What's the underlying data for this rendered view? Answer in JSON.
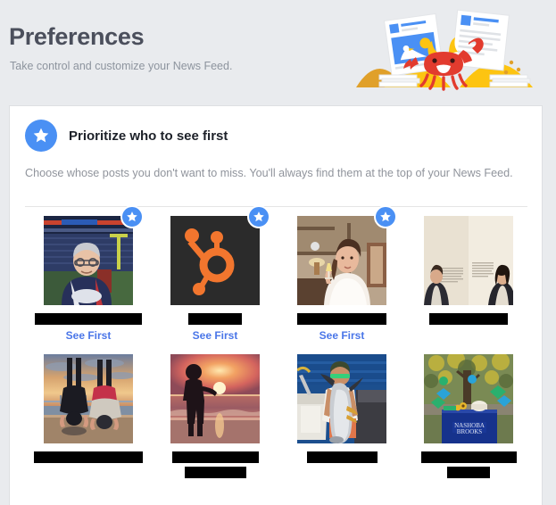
{
  "header": {
    "title": "Preferences",
    "subtitle": "Take control and customize your News Feed.",
    "illustration": "crab-newsfeed-illustration"
  },
  "section": {
    "icon": "star-icon",
    "title": "Prioritize who to see first",
    "description": "Choose whose posts you don't want to miss. You'll always find them at the top of your News Feed."
  },
  "colors": {
    "page_background": "#e9ebee",
    "card_background": "#ffffff",
    "accent_blue": "#4a90f4",
    "link_blue": "#4a76e8",
    "title_grey": "#4b4f5c",
    "body_grey": "#90949c",
    "redaction": "#000000"
  },
  "see_first_label": "See First",
  "tiles": [
    {
      "image": "man-in-football-stadium-photo",
      "selected": true,
      "badge": "star-icon",
      "action_label": "See First",
      "redactions": [
        120
      ]
    },
    {
      "image": "hubspot-sprocket-logo",
      "selected": true,
      "badge": "star-icon",
      "action_label": "See First",
      "redactions": [
        60
      ]
    },
    {
      "image": "bride-with-champagne-photo",
      "selected": true,
      "badge": "star-icon",
      "action_label": "See First",
      "redactions": [
        100
      ]
    },
    {
      "image": "two-people-against-wall-photo",
      "selected": false,
      "badge": null,
      "action_label": null,
      "redactions": [
        88
      ]
    },
    {
      "image": "headstands-at-sunset-photo",
      "selected": false,
      "badge": null,
      "action_label": null,
      "redactions": [
        122
      ]
    },
    {
      "image": "silhouette-sunset-beach-photo",
      "selected": false,
      "badge": null,
      "action_label": null,
      "redactions": [
        97,
        69
      ]
    },
    {
      "image": "man-holding-tuna-on-boat-photo",
      "selected": false,
      "badge": null,
      "action_label": null,
      "redactions": [
        79
      ]
    },
    {
      "image": "nashoba-brooks-table-photo",
      "selected": false,
      "badge": null,
      "action_label": null,
      "redactions": [
        107,
        48
      ]
    }
  ]
}
